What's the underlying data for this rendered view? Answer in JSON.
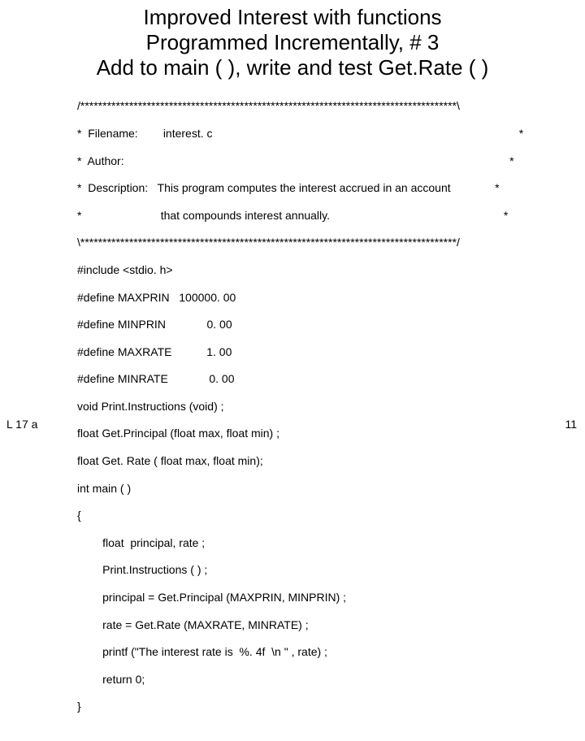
{
  "heading": {
    "line1": "Improved Interest  with functions",
    "line2": "Programmed Incrementally, # 3",
    "line3": "Add to main ( ), write and test Get.Rate ( )"
  },
  "comment": {
    "top": "/*************************************************************************************\\",
    "l1": "*  Filename:        interest. c                                                                                                 *",
    "l2": "*  Author:                                                                                                                          *",
    "l3": "*  Description:   This program computes the interest accrued in an account              *",
    "l4": "*                         that compounds interest annually.                                                       *",
    "bottom": "\\*************************************************************************************/"
  },
  "code": {
    "c1": "#include <stdio. h>",
    "c2": "#define MAXPRIN   100000. 00",
    "c3": "#define MINPRIN             0. 00",
    "c4": "#define MAXRATE           1. 00",
    "c5": "#define MINRATE             0. 00",
    "c6": "void Print.Instructions (void) ;",
    "c7": "float Get.Principal (float max, float min) ;",
    "c8": "float Get. Rate ( float max, float min);",
    "c9": "int main ( )",
    "c10": "{",
    "c11": "        float  principal, rate ;",
    "c12": "        Print.Instructions ( ) ;",
    "c13": "        principal = Get.Principal (MAXPRIN, MINPRIN) ;",
    "c14": "        rate = Get.Rate (MAXRATE, MINRATE) ;",
    "c15": "        printf (\"The interest rate is  %. 4f  \\n \" , rate) ;",
    "c16": "        return 0;",
    "c17": "}"
  },
  "footer": {
    "left": "L 17 a",
    "right": "11"
  }
}
